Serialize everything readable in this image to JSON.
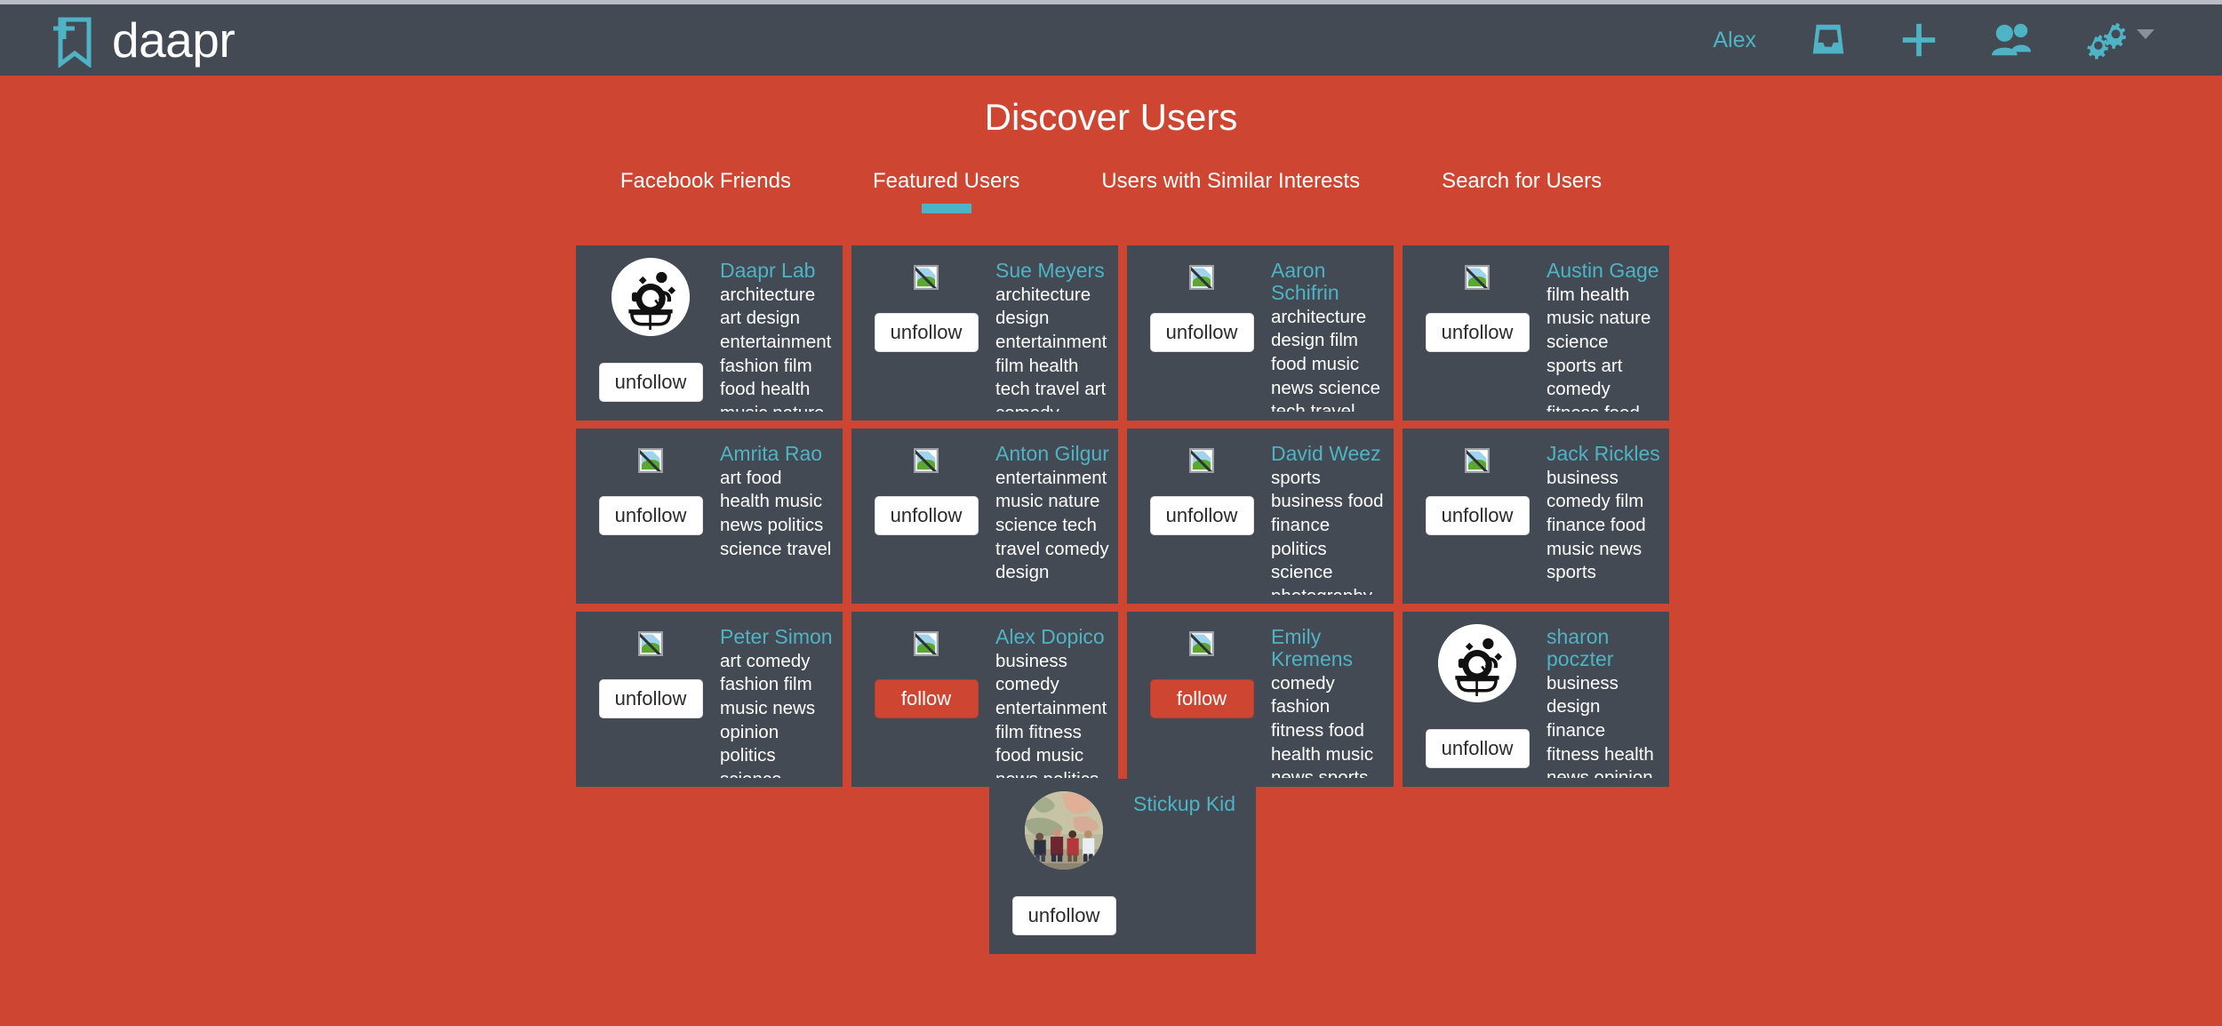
{
  "header": {
    "brand": "daapr",
    "logo_icon": "bookmark-plus-icon",
    "user": "Alex",
    "icons": [
      {
        "name": "inbox-icon",
        "label": "Inbox"
      },
      {
        "name": "plus-icon",
        "label": "Add"
      },
      {
        "name": "users-icon",
        "label": "Friends"
      },
      {
        "name": "cogs-icon",
        "label": "Settings"
      }
    ]
  },
  "page": {
    "title": "Discover Users"
  },
  "tabs": [
    {
      "label": "Facebook Friends",
      "active": false
    },
    {
      "label": "Featured Users",
      "active": true
    },
    {
      "label": "Users with Similar Interests",
      "active": false
    },
    {
      "label": "Search for Users",
      "active": false
    }
  ],
  "colors": {
    "background": "#ce4531",
    "card": "#434a53",
    "accent": "#4eb3c4",
    "header": "#434a53",
    "follow_button": "#ce4531",
    "unfollow_button": "#ffffff"
  },
  "buttons": {
    "follow": "follow",
    "unfollow": "unfollow"
  },
  "users": [
    {
      "name": "Daapr Lab",
      "tags": "architecture art design entertainment fashion film food health music nature news politics",
      "button": "unfollow",
      "avatar": "daapr-logo"
    },
    {
      "name": "Sue Meyers",
      "tags": "architecture design entertainment film health tech travel art comedy fitness literature",
      "button": "unfollow",
      "avatar": "broken-image"
    },
    {
      "name": "Aaron Schifrin",
      "tags": "architecture design film food music news science tech travel",
      "button": "unfollow",
      "avatar": "broken-image"
    },
    {
      "name": "Austin Gage",
      "tags": "film health music nature science sports art comedy fitness food literature opinion",
      "button": "unfollow",
      "avatar": "broken-image"
    },
    {
      "name": "Amrita Rao",
      "tags": "art food health music news politics science travel",
      "button": "unfollow",
      "avatar": "broken-image"
    },
    {
      "name": "Anton Gilgur",
      "tags": "entertainment music nature science tech travel comedy design",
      "button": "unfollow",
      "avatar": "broken-image"
    },
    {
      "name": "David Weez",
      "tags": "sports business food finance politics science photography opinion film news",
      "button": "unfollow",
      "avatar": "broken-image"
    },
    {
      "name": "Jack Rickles",
      "tags": "business comedy film finance food music news sports",
      "button": "unfollow",
      "avatar": "broken-image"
    },
    {
      "name": "Peter Simon",
      "tags": "art comedy fashion film music news opinion politics science sports",
      "button": "unfollow",
      "avatar": "broken-image"
    },
    {
      "name": "Alex Dopico",
      "tags": "business comedy entertainment film fitness food music news politics science sports",
      "button": "follow",
      "avatar": "broken-image"
    },
    {
      "name": "Emily Kremens",
      "tags": "comedy fashion fitness food health music news sports",
      "button": "follow",
      "avatar": "broken-image"
    },
    {
      "name": "sharon poczter",
      "tags": "business design finance fitness health news opinion politics science tech travel",
      "button": "unfollow",
      "avatar": "daapr-logo"
    },
    {
      "name": "Stickup Kid",
      "tags": "",
      "button": "unfollow",
      "avatar": "band-photo"
    }
  ]
}
